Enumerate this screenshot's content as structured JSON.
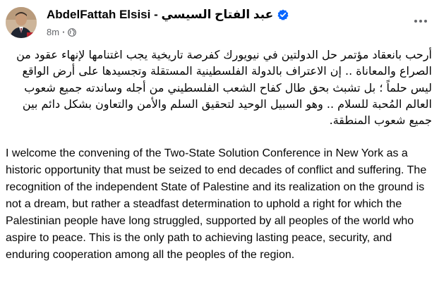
{
  "post": {
    "author": "AbdelFattah Elsisi - عبد الفتاح السيسي",
    "time": "8m",
    "meta_separator": "·",
    "arabic_text": "أرحب بانعقاد مؤتمر حل الدولتين في نيويورك كفرصة تاريخية يجب اغتنامها لإنهاء عقود من الصراع والمعاناة .. إن الاعتراف بالدولة الفلسطينية المستقلة وتجسيدها على أرض الواقع ليس حلماً ؛ بل تشبث بحق طال كفاح الشعب الفلسطيني من أجله وساندته جميع شعوب العالم المُحبة للسلام .. وهو السبيل الوحيد لتحقيق السلم والأمن والتعاون بشكل دائم بين جميع شعوب المنطقة.",
    "english_text": "I welcome the convening of the Two-State Solution Conference in New York as a historic opportunity that must be seized to end decades of conflict and suffering. The recognition of the independent State of Palestine and its realization on the ground is not a dream, but rather a steadfast determination to uphold a right for which the Palestinian people have long struggled, supported by all peoples of the world who aspire to peace. This is the only path to achieving lasting peace, security, and enduring cooperation among all the peoples of the region."
  },
  "icons": {
    "verified": "verified-badge-icon",
    "privacy": "globe-icon",
    "more": "more-options-icon"
  },
  "colors": {
    "verified_blue": "#0866ff",
    "meta_gray": "#65676b",
    "text": "#050505"
  }
}
